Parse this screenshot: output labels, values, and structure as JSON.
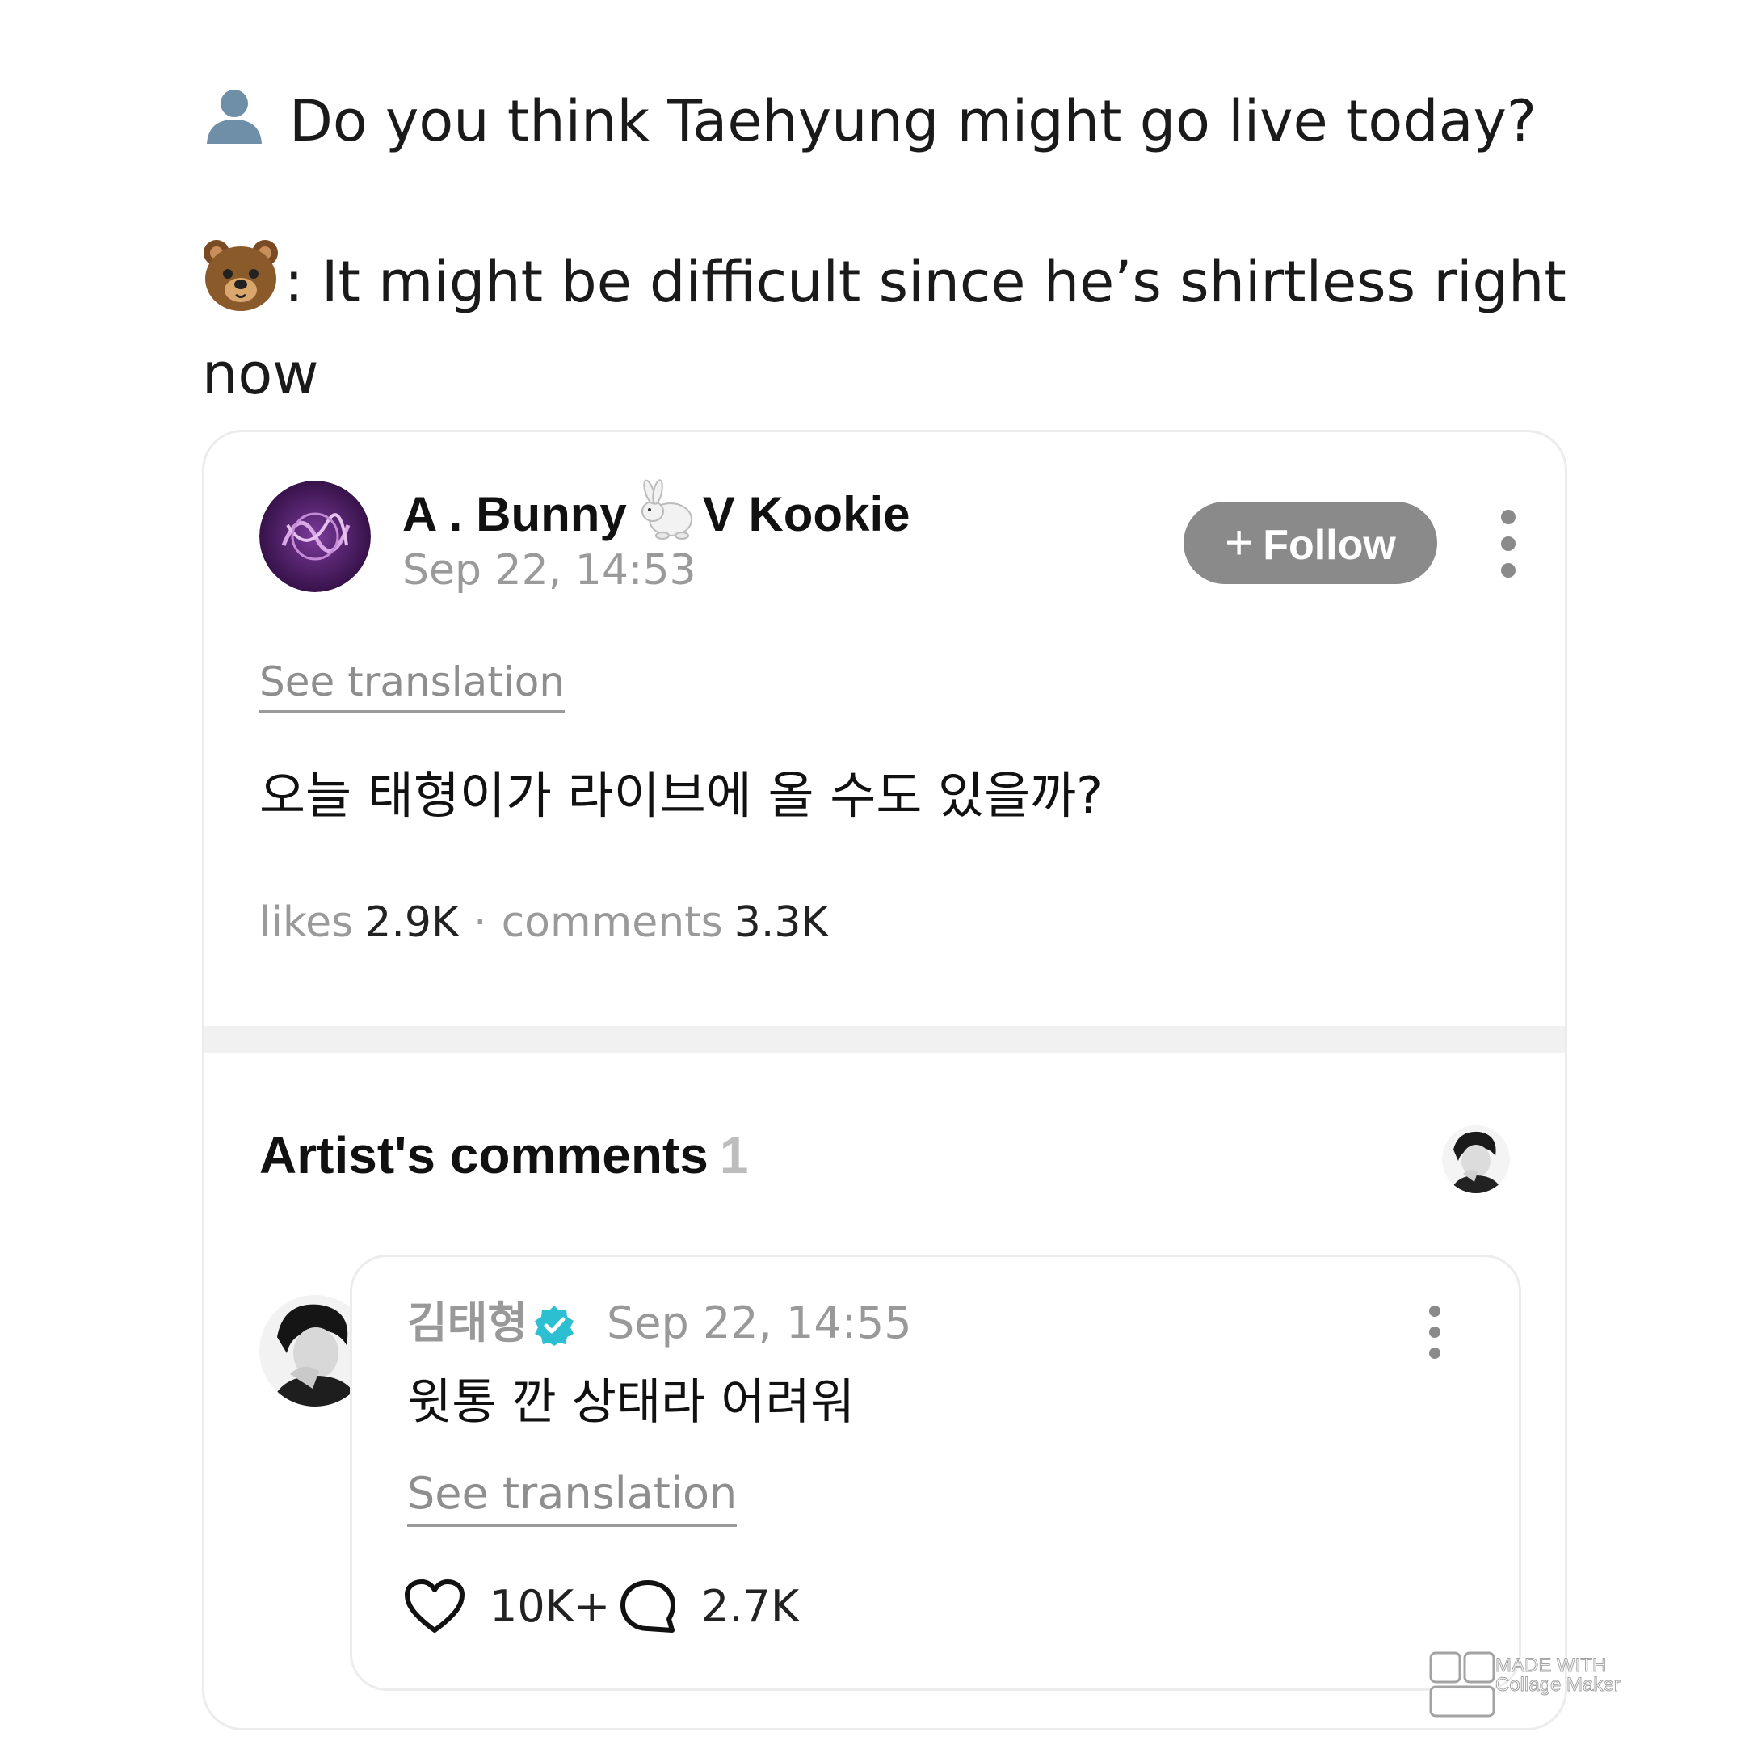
{
  "caption": {
    "question": "Do you think Taehyung might go live today?",
    "question_icon": "person-silhouette-icon",
    "answer": ": It might be difficult since he’s shirtless right now",
    "answer_icon": "bear-face-icon"
  },
  "post": {
    "author": "A . Bunny",
    "author_suffix": "V Kookie",
    "author_emoji": "rabbit-icon",
    "date": "Sep 22, 14:53",
    "follow_label": "Follow",
    "see_translation": "See translation",
    "body": "오늘 태형이가 라이브에 올 수도 있을까?",
    "likes_label": "likes",
    "likes": "2.9K",
    "comments_label": "comments",
    "comments": "3.3K"
  },
  "artist_comments": {
    "title": "Artist's comments",
    "count": "1",
    "comment": {
      "author": "김태형",
      "verified": true,
      "date": "Sep 22, 14:55",
      "body": "윗통 깐 상태라 어려워",
      "see_translation": "See translation",
      "likes": "10K+",
      "replies": "2.7K"
    }
  },
  "watermark": {
    "line1": "MADE WITH",
    "line2": "Collage Maker"
  },
  "colors": {
    "follow_button": "#8a8a8a",
    "verified": "#2bbfd1",
    "divider": "#f1f1f1"
  }
}
